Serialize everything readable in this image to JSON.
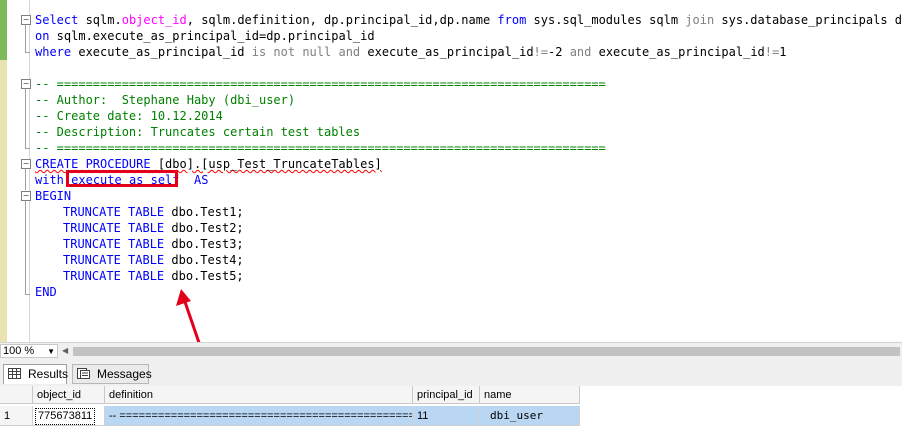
{
  "editor": {
    "query": {
      "l1": {
        "select": "Select",
        "a": " sqlm.",
        "obj": "object_id",
        "b": ", sqlm.definition, dp.principal_id,dp.name ",
        "from": "from",
        "c": " sys.sql_modules sqlm ",
        "join": "join",
        "d": " sys.database_principals dp"
      },
      "l2": {
        "on": "on",
        "rest": " sqlm.execute_as_principal_id=dp.principal_id"
      },
      "l3": {
        "where": "where",
        "a": " execute_as_principal_id ",
        "isnot": "is not null",
        "b": " ",
        "and1": "and",
        "c": " execute_as_principal_id",
        "ne1": "!=",
        "m2": "-2 ",
        "and2": "and",
        "d": " execute_as_principal_id",
        "ne2": "!=",
        "one": "1"
      }
    },
    "header_comment": [
      "-- ============================================================================",
      "-- Author:  Stephane Haby (dbi_user)",
      "-- Create date: 10.12.2014",
      "-- Description: Truncates certain test tables",
      "-- ============================================================================"
    ],
    "procedure": {
      "create_kw": "CREATE PROCEDURE",
      "name": " [dbo].[usp_Test_TruncateTables]",
      "with_kw": "with",
      "execute_as": "execute as self",
      "as_kw": "AS",
      "begin_kw": "BEGIN",
      "truncate_kw": "TRUNCATE TABLE",
      "tables": [
        "dbo.Test1",
        "dbo.Test2",
        "dbo.Test3",
        "dbo.Test4",
        "dbo.Test5"
      ],
      "end_kw": "END"
    }
  },
  "status": {
    "zoom": "100 %"
  },
  "result_tabs": {
    "results": "Results",
    "messages": "Messages"
  },
  "grid": {
    "columns": [
      "object_id",
      "definition",
      "principal_id",
      "name"
    ],
    "rows": [
      {
        "row_num": "1",
        "object_id": "775673811",
        "definition": "-- ===================================================",
        "principal_id": "11",
        "name": "dbi_user"
      }
    ]
  },
  "colors": {
    "highlight": "#e3001b",
    "keyword": "#0000ff",
    "comment": "#008000",
    "function": "#ff00ff",
    "selection": "#b9d7f3"
  }
}
